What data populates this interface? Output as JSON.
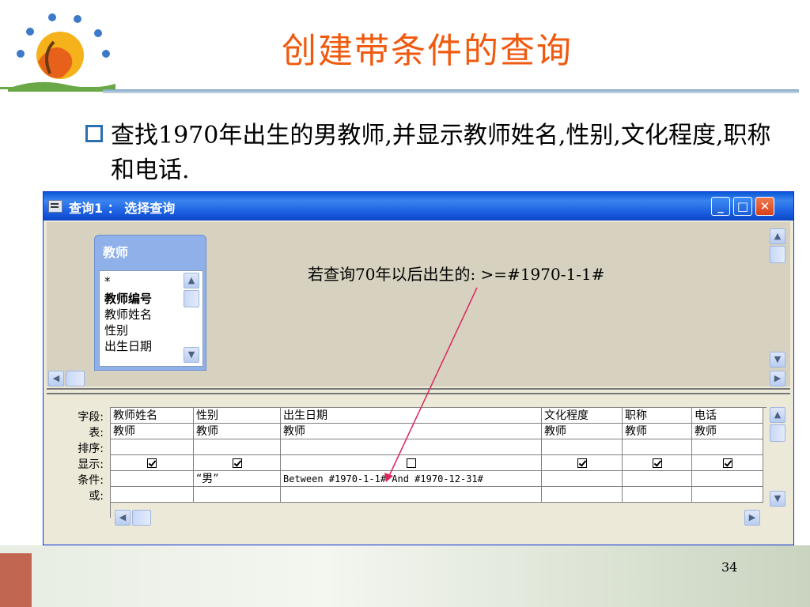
{
  "slide": {
    "title": "创建带条件的查询",
    "bullet": "查找1970年出生的男教师,并显示教师姓名,性别,文化程度,职称和电话.",
    "page_number": "34"
  },
  "window": {
    "title": "查询1 ： 选择查询",
    "min_glyph": "_",
    "max_glyph": "□",
    "close_glyph": "✕"
  },
  "table_box": {
    "name": "教师",
    "fields": [
      "*",
      "教师编号",
      "教师姓名",
      "性别",
      "出生日期"
    ]
  },
  "annotation": "若查询70年以后出生的:  >=#1970-1-1#",
  "grid": {
    "row_labels": [
      "字段:",
      "表:",
      "排序:",
      "显示:",
      "条件:",
      "或:"
    ],
    "columns": [
      {
        "field": "教师姓名",
        "table": "教师",
        "sort": "",
        "show": true,
        "criteria": "",
        "or": ""
      },
      {
        "field": "性别",
        "table": "教师",
        "sort": "",
        "show": true,
        "criteria": "“男”",
        "or": ""
      },
      {
        "field": "出生日期",
        "table": "教师",
        "sort": "",
        "show": false,
        "criteria": "Between #1970-1-1# And #1970-12-31#",
        "or": ""
      },
      {
        "field": "文化程度",
        "table": "教师",
        "sort": "",
        "show": true,
        "criteria": "",
        "or": ""
      },
      {
        "field": "职称",
        "table": "教师",
        "sort": "",
        "show": true,
        "criteria": "",
        "or": ""
      },
      {
        "field": "电话",
        "table": "教师",
        "sort": "",
        "show": true,
        "criteria": "",
        "or": ""
      }
    ]
  },
  "colors": {
    "title": "#f05a0f",
    "titlebar": "#0a58d6",
    "arrow": "#e0245e"
  }
}
